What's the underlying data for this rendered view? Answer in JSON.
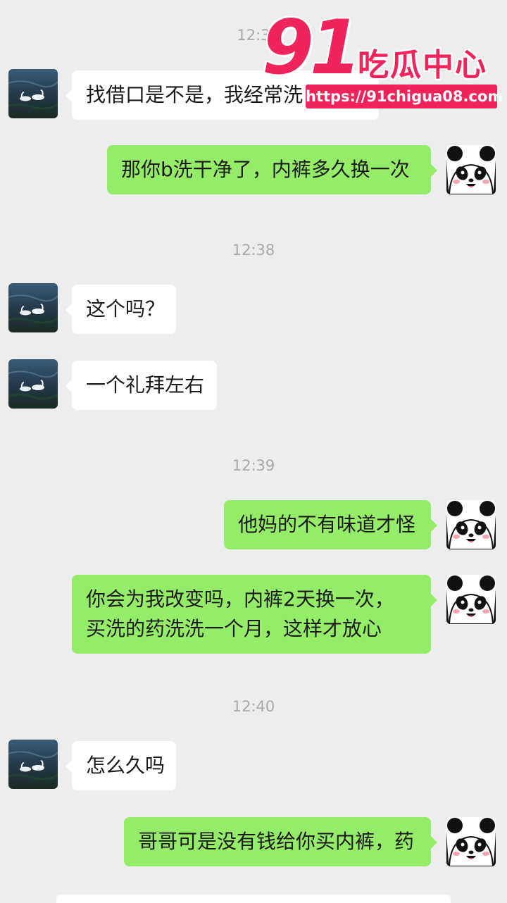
{
  "watermark": {
    "number": "91",
    "name": "吃瓜中心",
    "url": "https://91chigua08.com"
  },
  "messages": [
    {
      "type": "time",
      "text": "12:3"
    },
    {
      "type": "msg",
      "side": "left",
      "lines": [
        "找借口是不是，我经常洗"
      ]
    },
    {
      "type": "msg",
      "side": "right",
      "lines": [
        "那你b洗干净了，内裤多久换一次"
      ]
    },
    {
      "type": "time",
      "text": "12:38"
    },
    {
      "type": "msg",
      "side": "left",
      "lines": [
        "这个吗？"
      ]
    },
    {
      "type": "msg",
      "side": "left",
      "lines": [
        "一个礼拜左右"
      ]
    },
    {
      "type": "time",
      "text": "12:39"
    },
    {
      "type": "msg",
      "side": "right",
      "lines": [
        "他妈的不有味道才怪"
      ]
    },
    {
      "type": "msg",
      "side": "right",
      "lines": [
        "你会为我改变吗，内裤2天换一次，",
        "买洗的药洗洗一个月，这样才放心"
      ]
    },
    {
      "type": "time",
      "text": "12:40"
    },
    {
      "type": "msg",
      "side": "left",
      "lines": [
        "怎么久吗"
      ]
    },
    {
      "type": "msg",
      "side": "right",
      "lines": [
        "哥哥可是没有钱给你买内裤，药"
      ]
    }
  ]
}
